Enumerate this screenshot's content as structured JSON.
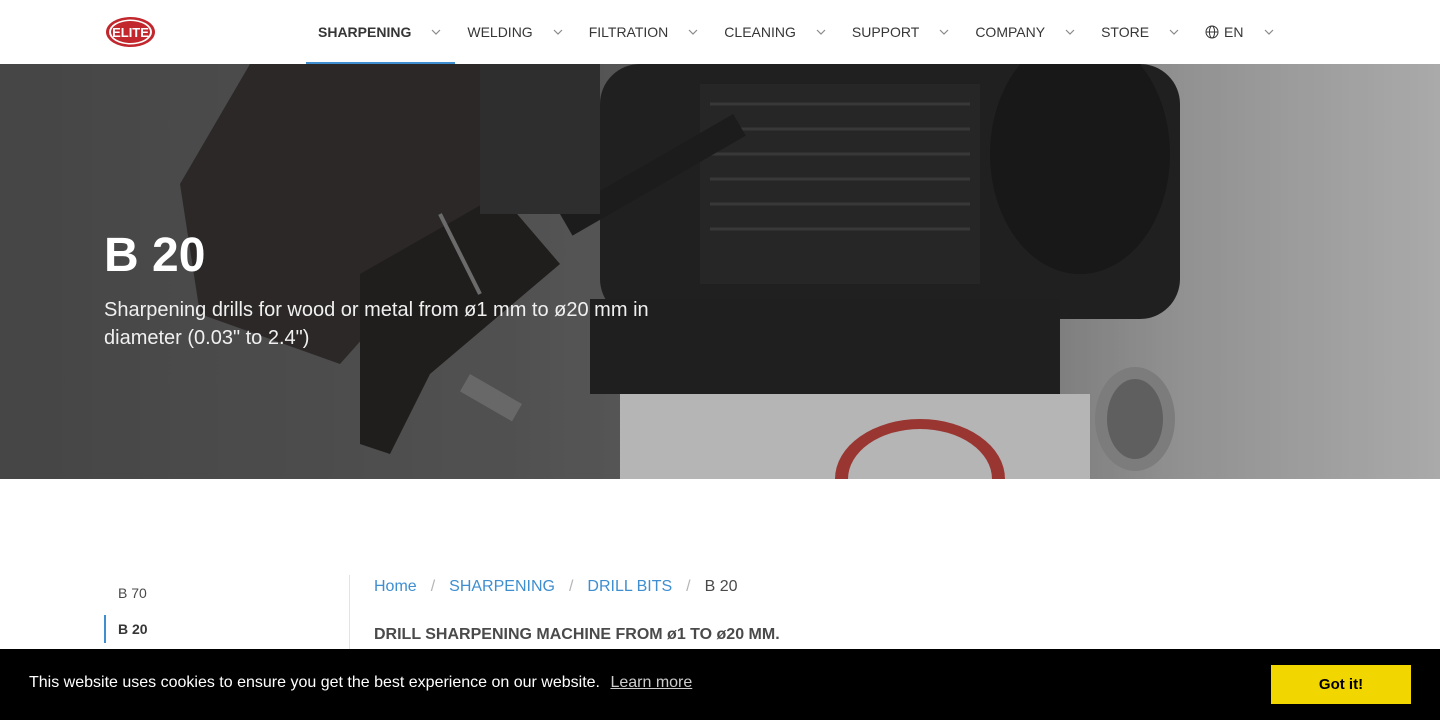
{
  "brand": {
    "logo_text": "ELITE",
    "logo_color": "#c1272d"
  },
  "nav": {
    "items": [
      {
        "label": "SHARPENING"
      },
      {
        "label": "WELDING"
      },
      {
        "label": "FILTRATION"
      },
      {
        "label": "CLEANING"
      },
      {
        "label": "SUPPORT"
      },
      {
        "label": "COMPANY"
      },
      {
        "label": "STORE"
      }
    ],
    "language": "EN",
    "accent": "#3e8ed0"
  },
  "hero": {
    "title": "B 20",
    "subtitle": "Sharpening drills for wood or metal from ø1 mm to ø20 mm in diameter (0.03\" to 2.4\")"
  },
  "sidebar": {
    "items": [
      {
        "label": "B 70"
      },
      {
        "label": "B 20"
      }
    ]
  },
  "breadcrumb": {
    "home": "Home",
    "level1": "SHARPENING",
    "level2": "DRILL BITS",
    "current": "B 20",
    "separator": "/"
  },
  "content": {
    "heading": "DRILL SHARPENING MACHINE FROM ø1 TO ø20 MM."
  },
  "cookie": {
    "message": "This website uses cookies to ensure you get the best experience on our website.",
    "learn_more": "Learn more",
    "accept": "Got it!",
    "button_color": "#f1d600"
  }
}
